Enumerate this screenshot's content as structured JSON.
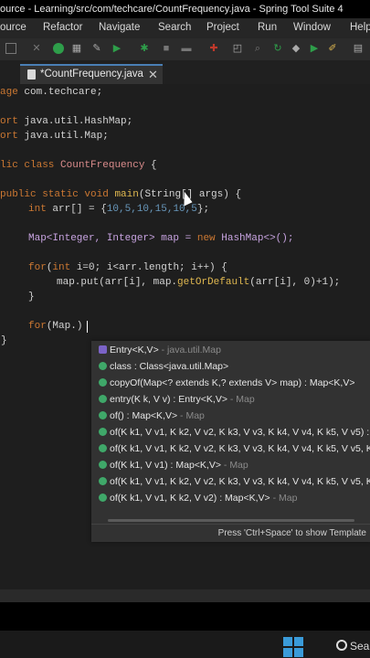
{
  "window": {
    "title": "ource - Learning/src/com/techcare/CountFrequency.java - Spring Tool Suite 4"
  },
  "menu": [
    "ource",
    "Refactor",
    "Navigate",
    "Search",
    "Project",
    "Run",
    "Window",
    "Help"
  ],
  "tab": {
    "label": "*CountFrequency.java"
  },
  "code": {
    "l1a": "age",
    "l1b": " com.techcare;",
    "l2a": "ort",
    "l2b": " java.util.HashMap;",
    "l3a": "ort",
    "l3b": " java.util.Map;",
    "l4a": "lic class",
    "l4b": "CountFrequency",
    "l5a": "public static void",
    "l5b": "main",
    "l5c": "(String[] args) {",
    "l6a": "int",
    "l6b": " arr[] = {",
    "l6c": "10,5,10,15,10,5",
    "l6d": "};",
    "l7a": "Map<Integer, Integer> map = ",
    "l7b": "new",
    "l7c": " HashMap<>();",
    "l8a": "for",
    "l8b": "(",
    "l8c": "int",
    "l8d": " i=0; i<arr.length; i++) {",
    "l9a": "map.put(arr[i], map.",
    "l9b": "getOrDefault",
    "l9c": "(arr[i], 0)+1);",
    "l10": "}",
    "l11a": "for",
    "l11b": "(Map.)",
    "l12": "}"
  },
  "autocomplete": {
    "items": [
      {
        "icon": "type-icon",
        "text": "Entry<K,V>",
        "qual": " - java.util.Map"
      },
      {
        "icon": "field-icon",
        "text": "class : Class<java.util.Map>",
        "qual": ""
      },
      {
        "icon": "method-icon",
        "text": "copyOf(Map<? extends K,? extends V> map) : Map<K,V>",
        "qual": ""
      },
      {
        "icon": "method-icon",
        "text": "entry(K k, V v) : Entry<K,V>",
        "qual": " - Map"
      },
      {
        "icon": "method-icon",
        "text": "of() : Map<K,V>",
        "qual": " - Map"
      },
      {
        "icon": "method-icon",
        "text": "of(K k1, V v1, K k2, V v2, K k3, V v3, K k4, V v4, K k5, V v5) :",
        "qual": ""
      },
      {
        "icon": "method-icon",
        "text": "of(K k1, V v1, K k2, V v2, K k3, V v3, K k4, V v4, K k5, V v5, K",
        "qual": ""
      },
      {
        "icon": "method-icon",
        "text": "of(K k1, V v1) : Map<K,V>",
        "qual": " - Map"
      },
      {
        "icon": "method-icon",
        "text": "of(K k1, V v1, K k2, V v2, K k3, V v3, K k4, V v4, K k5, V v5, K",
        "qual": ""
      },
      {
        "icon": "method-icon",
        "text": "of(K k1, V v1, K k2, V v2) : Map<K,V>",
        "qual": " - Map"
      }
    ],
    "status": "Press 'Ctrl+Space' to show Template"
  },
  "taskbar": {
    "search_label": "Sear"
  },
  "colors": {
    "keyword": "#cc7832",
    "class": "#d98b8b",
    "accent": "#3a9bd9"
  }
}
